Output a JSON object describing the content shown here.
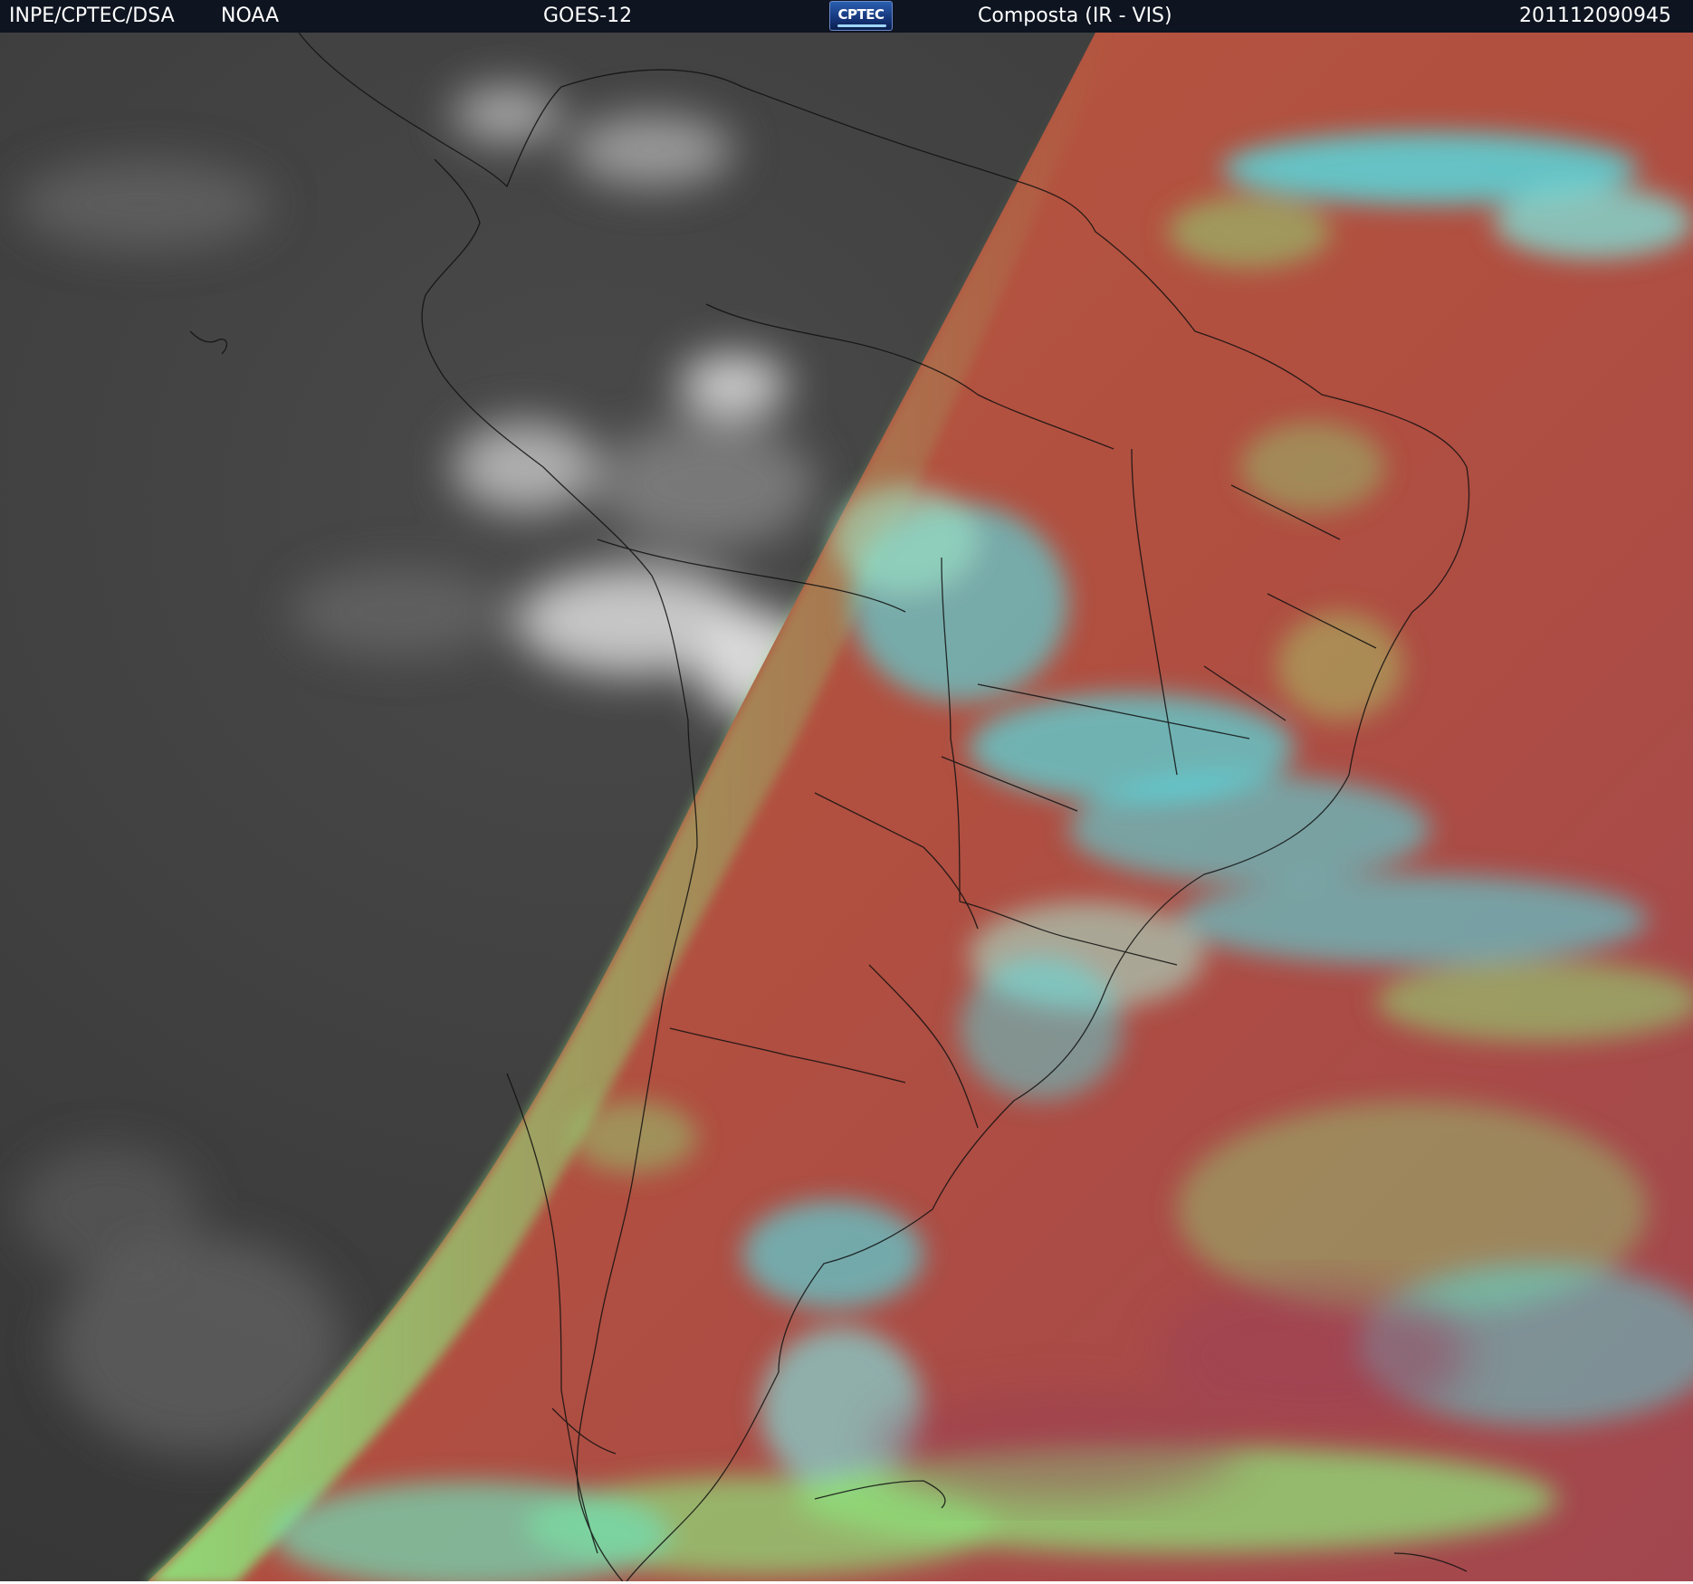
{
  "header": {
    "organization": "INPE/CPTEC/DSA",
    "agency": "NOAA",
    "satellite": "GOES-12",
    "logo_text": "CPTEC",
    "product": "Composta (IR - VIS)",
    "timestamp": "201112090945"
  },
  "imagery": {
    "night_side": "infrared-grayscale",
    "day_side": "false-color-composite",
    "colors": {
      "land_day": "#b5553f",
      "ocean_day": "#b24a3e",
      "cloud_low": "#8fe07a",
      "cloud_high": "#4ee8f0",
      "night_background": "#3c3c3c",
      "night_cloud": "#cfcfcf",
      "borders": "#111111"
    }
  }
}
